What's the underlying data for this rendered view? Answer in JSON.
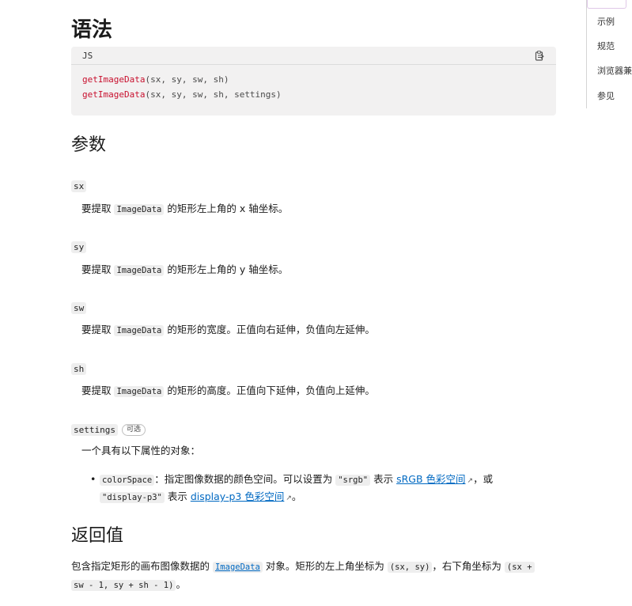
{
  "syntax": {
    "title": "语法",
    "lang": "JS",
    "code_lines": [
      {
        "fn": "getImageData",
        "args": "(sx, sy, sw, sh)"
      },
      {
        "fn": "getImageData",
        "args": "(sx, sy, sw, sh, settings)"
      }
    ]
  },
  "params": {
    "title": "参数",
    "items": [
      {
        "name": "sx",
        "pre": "要提取 ",
        "code": "ImageData",
        "post": " 的矩形左上角的 x 轴坐标。"
      },
      {
        "name": "sy",
        "pre": "要提取 ",
        "code": "ImageData",
        "post": " 的矩形左上角的 y 轴坐标。"
      },
      {
        "name": "sw",
        "pre": "要提取 ",
        "code": "ImageData",
        "post": " 的矩形的宽度。正值向右延伸，负值向左延伸。"
      },
      {
        "name": "sh",
        "pre": "要提取 ",
        "code": "ImageData",
        "post": " 的矩形的高度。正值向下延伸，负值向上延伸。"
      }
    ],
    "settings": {
      "name": "settings",
      "badge": "可选",
      "desc": "一个具有以下属性的对象：",
      "bullet": {
        "code": "colorSpace",
        "text1": "：指定图像数据的颜色空间。可以设置为 ",
        "val1": "\"srgb\"",
        "text2": " 表示 ",
        "link1": "sRGB 色彩空间",
        "text3": "，或",
        "val2": "\"display-p3\"",
        "text4": " 表示 ",
        "link2": "display-p3 色彩空间",
        "text5": "。"
      }
    }
  },
  "returns": {
    "title": "返回值",
    "line1_pre": "包含指定矩形的画布图像数据的 ",
    "line1_link": "ImageData",
    "line1_mid": " 对象。矩形的左上角坐标为 ",
    "line1_code1": "(sx, sy)",
    "line1_mid2": "，右下角坐标为 ",
    "line1_code2": "(sx +",
    "line2_code": "sw - 1, sy + sh - 1)",
    "line2_post": "。"
  },
  "toc": {
    "items": [
      "示例",
      "规范",
      "浏览器兼",
      "参见"
    ]
  },
  "icons": {
    "copy": "copy-icon",
    "external": "external-link-icon"
  },
  "colors": {
    "function_name": "#c8102e",
    "link": "#0069c2"
  }
}
